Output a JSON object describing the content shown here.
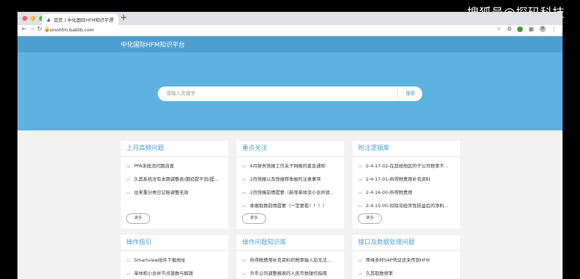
{
  "watermark": "搜狐号@探码科技",
  "browser": {
    "tab_title": "首页 | 中化国际HFM知识平台",
    "url": "sinohfm.baklib.com",
    "avatar_text": "R"
  },
  "site": {
    "brand": "中化国际HFM知识平台",
    "search_placeholder": "请输入关键字",
    "search_button": "搜索"
  },
  "more_label": "更多",
  "cards_row1": [
    {
      "title": "上月高频问题",
      "items": [
        "PPA未抵消问题自查",
        "久其系统没有本期调整表/期初提不到/提...",
        "往来重分类日记账调整无效"
      ]
    },
    {
      "title": "重点关注",
      "items": [
        "4月财务快报工作关于网络的紧急通知",
        "2月快报以及快报转季报的注意事项",
        "2月快报前情提要（新增单体及小合并锁...",
        "季报取数前情提要（一定要看！！！）"
      ]
    },
    {
      "title": "附注逻辑库",
      "items": [
        "2-4-17-02-在其他地区的子公司税率不...",
        "2-4-17-01-所得税费用补充资料",
        "2-4-16-00-所得税费用",
        "2-4-15-00-扣除非经常性损益后的净利..."
      ]
    }
  ],
  "cards_row2": [
    {
      "title": "操作指引",
      "items": [
        "Smartview插件下载地址",
        "单体和小合并节点锁数与解锁"
      ]
    },
    {
      "title": "操作问题知识库",
      "items": [
        "所得税费用补充资料的税率输入后无法...",
        "外币公司调整报表的人民币数操作指南"
      ]
    },
    {
      "title": "接口及数据处理问题",
      "items": [
        "等待多时SAP凭证还未传到HFM",
        "久其取数频率"
      ]
    }
  ]
}
